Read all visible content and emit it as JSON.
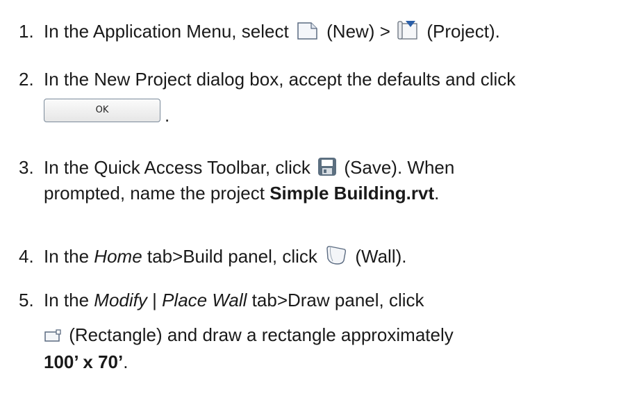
{
  "steps": [
    {
      "num": "1.",
      "a": "In the Application Menu, select",
      "b": "(New) >",
      "c": "(Project).",
      "icons": [
        "new-document-icon",
        "project-template-icon"
      ]
    },
    {
      "num": "2.",
      "a": "In the New Project dialog box, accept the defaults and click",
      "button_label": "OK",
      "end": "."
    },
    {
      "num": "3.",
      "a": "In the Quick Access Toolbar, click",
      "b": "(Save). When",
      "line2_a": "prompted, name the project",
      "line2_bold": "Simple Building.rvt",
      "line2_end": ".",
      "icons": [
        "save-icon"
      ]
    },
    {
      "num": "4.",
      "a": "In the",
      "italic": "Home",
      "b": "tab>Build panel, click",
      "c": "(Wall).",
      "icons": [
        "wall-icon"
      ]
    },
    {
      "num": "5.",
      "a": "In the",
      "italic1": "Modify",
      "sep": " | ",
      "italic2": "Place Wall",
      "b": "tab>Draw panel, click",
      "line2": "(Rectangle) and draw a rectangle approximately",
      "line3_bold": "100’ x 70’",
      "line3_end": ".",
      "icons": [
        "rectangle-icon"
      ]
    }
  ]
}
